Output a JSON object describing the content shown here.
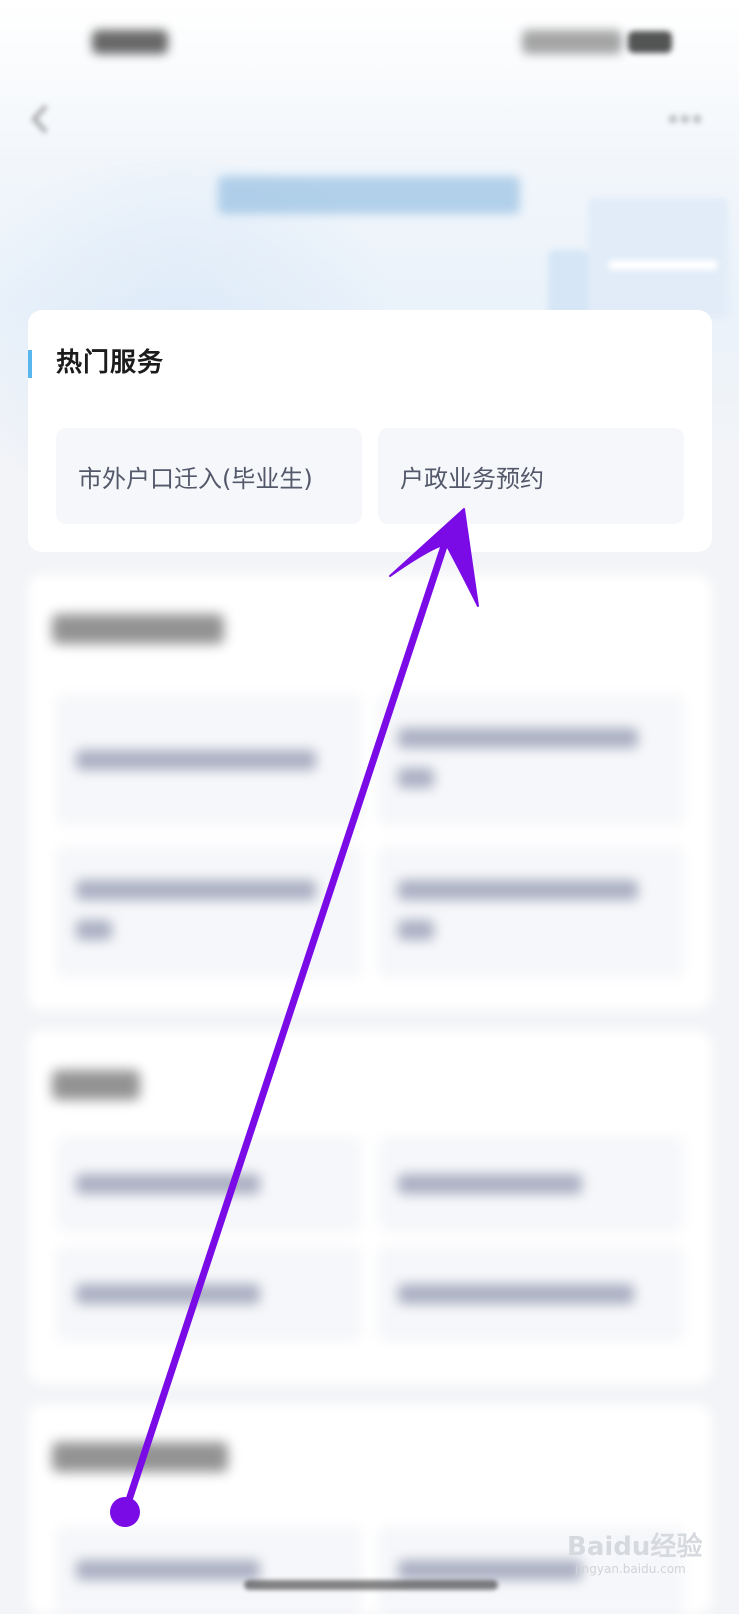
{
  "hot_services": {
    "title": "热门服务",
    "items": [
      {
        "label": "市外户口迁入(毕业生)"
      },
      {
        "label": "户政业务预约"
      }
    ]
  },
  "watermark": {
    "brand": "Baidu经验",
    "domain": "jingyan.baidu.com"
  },
  "colors": {
    "accent": "#59b7ee",
    "annotation_arrow": "#7a0ae6",
    "card_background": "#ffffff",
    "page_background": "#f3f4f7",
    "item_background": "#f6f7fa",
    "item_text": "#53586a"
  }
}
